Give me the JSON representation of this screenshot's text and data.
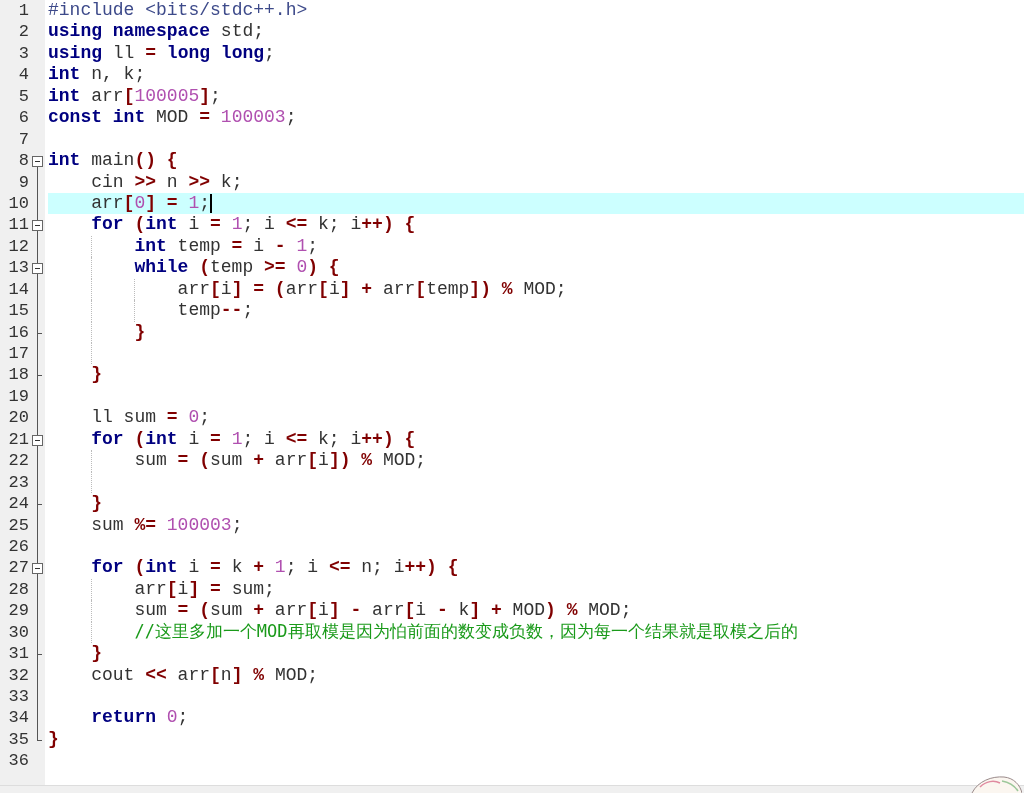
{
  "editor": {
    "lines": [
      {
        "number": "1",
        "kind": "code",
        "current": false,
        "tokens": [
          {
            "kind": "preprocessor",
            "text": "#include <bits/stdc++.h>"
          }
        ]
      },
      {
        "number": "2",
        "kind": "code",
        "current": false,
        "tokens": [
          {
            "kind": "keyword",
            "text": "using namespace"
          },
          {
            "kind": "plain",
            "text": " std;"
          }
        ]
      },
      {
        "number": "3",
        "kind": "code",
        "current": false,
        "tokens": [
          {
            "kind": "keyword",
            "text": "using"
          },
          {
            "kind": "plain",
            "text": " ll "
          },
          {
            "kind": "operator",
            "text": "="
          },
          {
            "kind": "keyword",
            "text": " long long"
          },
          {
            "kind": "plain",
            "text": ";"
          }
        ]
      },
      {
        "number": "4",
        "kind": "code",
        "current": false,
        "tokens": [
          {
            "kind": "keyword",
            "text": "int"
          },
          {
            "kind": "plain",
            "text": " n, k;"
          }
        ]
      },
      {
        "number": "5",
        "kind": "code",
        "current": false,
        "tokens": [
          {
            "kind": "keyword",
            "text": "int"
          },
          {
            "kind": "plain",
            "text": " arr"
          },
          {
            "kind": "operator",
            "text": "["
          },
          {
            "kind": "number",
            "text": "100005"
          },
          {
            "kind": "operator",
            "text": "]"
          },
          {
            "kind": "plain",
            "text": ";"
          }
        ]
      },
      {
        "number": "6",
        "kind": "code",
        "current": false,
        "tokens": [
          {
            "kind": "keyword",
            "text": "const int"
          },
          {
            "kind": "plain",
            "text": " MOD "
          },
          {
            "kind": "operator",
            "text": "="
          },
          {
            "kind": "number",
            "text": " 100003"
          },
          {
            "kind": "plain",
            "text": ";"
          }
        ]
      },
      {
        "number": "7",
        "kind": "blank",
        "current": false
      },
      {
        "number": "8",
        "kind": "code",
        "current": false,
        "tokens": [
          {
            "kind": "keyword",
            "text": "int"
          },
          {
            "kind": "plain",
            "text": " main"
          },
          {
            "kind": "operator",
            "text": "() {"
          }
        ],
        "children": [
          {
            "number": "9",
            "kind": "code",
            "current": false,
            "tokens": [
              {
                "kind": "plain",
                "text": "cin "
              },
              {
                "kind": "operator",
                "text": ">>"
              },
              {
                "kind": "plain",
                "text": " n "
              },
              {
                "kind": "operator",
                "text": ">>"
              },
              {
                "kind": "plain",
                "text": " k;"
              }
            ]
          },
          {
            "number": "10",
            "kind": "code",
            "current": true,
            "tokens": [
              {
                "kind": "plain",
                "text": "arr"
              },
              {
                "kind": "operator",
                "text": "["
              },
              {
                "kind": "number",
                "text": "0"
              },
              {
                "kind": "operator",
                "text": "]"
              },
              {
                "kind": "operator",
                "text": " ="
              },
              {
                "kind": "number",
                "text": " 1"
              },
              {
                "kind": "plain",
                "text": ";"
              }
            ]
          },
          {
            "number": "11",
            "kind": "code",
            "current": false,
            "tokens": [
              {
                "kind": "keyword",
                "text": "for"
              },
              {
                "kind": "operator",
                "text": " ("
              },
              {
                "kind": "keyword",
                "text": "int"
              },
              {
                "kind": "plain",
                "text": " i "
              },
              {
                "kind": "operator",
                "text": "="
              },
              {
                "kind": "number",
                "text": " 1"
              },
              {
                "kind": "plain",
                "text": "; i "
              },
              {
                "kind": "operator",
                "text": "<="
              },
              {
                "kind": "plain",
                "text": " k; i"
              },
              {
                "kind": "operator",
                "text": "++) {"
              }
            ],
            "children": [
              {
                "number": "12",
                "kind": "code",
                "current": false,
                "tokens": [
                  {
                    "kind": "keyword",
                    "text": "int"
                  },
                  {
                    "kind": "plain",
                    "text": " temp "
                  },
                  {
                    "kind": "operator",
                    "text": "="
                  },
                  {
                    "kind": "plain",
                    "text": " i "
                  },
                  {
                    "kind": "operator",
                    "text": "-"
                  },
                  {
                    "kind": "number",
                    "text": " 1"
                  },
                  {
                    "kind": "plain",
                    "text": ";"
                  }
                ]
              },
              {
                "number": "13",
                "kind": "code",
                "current": false,
                "tokens": [
                  {
                    "kind": "keyword",
                    "text": "while"
                  },
                  {
                    "kind": "operator",
                    "text": " ("
                  },
                  {
                    "kind": "plain",
                    "text": "temp "
                  },
                  {
                    "kind": "operator",
                    "text": ">="
                  },
                  {
                    "kind": "number",
                    "text": " 0"
                  },
                  {
                    "kind": "operator",
                    "text": ") {"
                  }
                ],
                "children": [
                  {
                    "number": "14",
                    "kind": "code",
                    "current": false,
                    "tokens": [
                      {
                        "kind": "plain",
                        "text": "arr"
                      },
                      {
                        "kind": "operator",
                        "text": "["
                      },
                      {
                        "kind": "plain",
                        "text": "i"
                      },
                      {
                        "kind": "operator",
                        "text": "]"
                      },
                      {
                        "kind": "operator",
                        "text": " = ("
                      },
                      {
                        "kind": "plain",
                        "text": "arr"
                      },
                      {
                        "kind": "operator",
                        "text": "["
                      },
                      {
                        "kind": "plain",
                        "text": "i"
                      },
                      {
                        "kind": "operator",
                        "text": "]"
                      },
                      {
                        "kind": "operator",
                        "text": " +"
                      },
                      {
                        "kind": "plain",
                        "text": " arr"
                      },
                      {
                        "kind": "operator",
                        "text": "["
                      },
                      {
                        "kind": "plain",
                        "text": "temp"
                      },
                      {
                        "kind": "operator",
                        "text": "])"
                      },
                      {
                        "kind": "operator",
                        "text": " %"
                      },
                      {
                        "kind": "plain",
                        "text": " MOD;"
                      }
                    ]
                  },
                  {
                    "number": "15",
                    "kind": "code",
                    "current": false,
                    "tokens": [
                      {
                        "kind": "plain",
                        "text": "temp"
                      },
                      {
                        "kind": "operator",
                        "text": "--"
                      },
                      {
                        "kind": "plain",
                        "text": ";"
                      }
                    ]
                  }
                ]
              },
              {
                "number": "16",
                "kind": "block_end",
                "current": false,
                "tokens": [
                  {
                    "kind": "operator",
                    "text": "}"
                  }
                ]
              },
              {
                "number": "17",
                "kind": "blank",
                "current": false
              }
            ]
          },
          {
            "number": "18",
            "kind": "block_end",
            "current": false,
            "tokens": [
              {
                "kind": "operator",
                "text": "}"
              }
            ]
          },
          {
            "number": "19",
            "kind": "blank",
            "current": false
          },
          {
            "number": "20",
            "kind": "code",
            "current": false,
            "tokens": [
              {
                "kind": "plain",
                "text": "ll sum "
              },
              {
                "kind": "operator",
                "text": "="
              },
              {
                "kind": "number",
                "text": " 0"
              },
              {
                "kind": "plain",
                "text": ";"
              }
            ]
          },
          {
            "number": "21",
            "kind": "code",
            "current": false,
            "tokens": [
              {
                "kind": "keyword",
                "text": "for"
              },
              {
                "kind": "operator",
                "text": " ("
              },
              {
                "kind": "keyword",
                "text": "int"
              },
              {
                "kind": "plain",
                "text": " i "
              },
              {
                "kind": "operator",
                "text": "="
              },
              {
                "kind": "number",
                "text": " 1"
              },
              {
                "kind": "plain",
                "text": "; i "
              },
              {
                "kind": "operator",
                "text": "<="
              },
              {
                "kind": "plain",
                "text": " k; i"
              },
              {
                "kind": "operator",
                "text": "++) {"
              }
            ],
            "children": [
              {
                "number": "22",
                "kind": "code",
                "current": false,
                "tokens": [
                  {
                    "kind": "plain",
                    "text": "sum "
                  },
                  {
                    "kind": "operator",
                    "text": "= ("
                  },
                  {
                    "kind": "plain",
                    "text": "sum "
                  },
                  {
                    "kind": "operator",
                    "text": "+"
                  },
                  {
                    "kind": "plain",
                    "text": " arr"
                  },
                  {
                    "kind": "operator",
                    "text": "["
                  },
                  {
                    "kind": "plain",
                    "text": "i"
                  },
                  {
                    "kind": "operator",
                    "text": "])"
                  },
                  {
                    "kind": "operator",
                    "text": " %"
                  },
                  {
                    "kind": "plain",
                    "text": " MOD;"
                  }
                ]
              },
              {
                "number": "23",
                "kind": "blank",
                "current": false
              }
            ]
          },
          {
            "number": "24",
            "kind": "block_end",
            "current": false,
            "tokens": [
              {
                "kind": "operator",
                "text": "}"
              }
            ]
          },
          {
            "number": "25",
            "kind": "code",
            "current": false,
            "tokens": [
              {
                "kind": "plain",
                "text": "sum "
              },
              {
                "kind": "operator",
                "text": "%="
              },
              {
                "kind": "number",
                "text": " 100003"
              },
              {
                "kind": "plain",
                "text": ";"
              }
            ]
          },
          {
            "number": "26",
            "kind": "blank",
            "current": false
          },
          {
            "number": "27",
            "kind": "code",
            "current": false,
            "tokens": [
              {
                "kind": "keyword",
                "text": "for"
              },
              {
                "kind": "operator",
                "text": " ("
              },
              {
                "kind": "keyword",
                "text": "int"
              },
              {
                "kind": "plain",
                "text": " i "
              },
              {
                "kind": "operator",
                "text": "="
              },
              {
                "kind": "plain",
                "text": " k "
              },
              {
                "kind": "operator",
                "text": "+"
              },
              {
                "kind": "number",
                "text": " 1"
              },
              {
                "kind": "plain",
                "text": "; i "
              },
              {
                "kind": "operator",
                "text": "<="
              },
              {
                "kind": "plain",
                "text": " n; i"
              },
              {
                "kind": "operator",
                "text": "++) {"
              }
            ],
            "children": [
              {
                "number": "28",
                "kind": "code",
                "current": false,
                "tokens": [
                  {
                    "kind": "plain",
                    "text": "arr"
                  },
                  {
                    "kind": "operator",
                    "text": "["
                  },
                  {
                    "kind": "plain",
                    "text": "i"
                  },
                  {
                    "kind": "operator",
                    "text": "]"
                  },
                  {
                    "kind": "operator",
                    "text": " ="
                  },
                  {
                    "kind": "plain",
                    "text": " sum;"
                  }
                ]
              },
              {
                "number": "29",
                "kind": "code",
                "current": false,
                "tokens": [
                  {
                    "kind": "plain",
                    "text": "sum "
                  },
                  {
                    "kind": "operator",
                    "text": "= ("
                  },
                  {
                    "kind": "plain",
                    "text": "sum "
                  },
                  {
                    "kind": "operator",
                    "text": "+"
                  },
                  {
                    "kind": "plain",
                    "text": " arr"
                  },
                  {
                    "kind": "operator",
                    "text": "["
                  },
                  {
                    "kind": "plain",
                    "text": "i"
                  },
                  {
                    "kind": "operator",
                    "text": "]"
                  },
                  {
                    "kind": "operator",
                    "text": " -"
                  },
                  {
                    "kind": "plain",
                    "text": " arr"
                  },
                  {
                    "kind": "operator",
                    "text": "["
                  },
                  {
                    "kind": "plain",
                    "text": "i "
                  },
                  {
                    "kind": "operator",
                    "text": "-"
                  },
                  {
                    "kind": "plain",
                    "text": " k"
                  },
                  {
                    "kind": "operator",
                    "text": "]"
                  },
                  {
                    "kind": "operator",
                    "text": " +"
                  },
                  {
                    "kind": "plain",
                    "text": " MOD"
                  },
                  {
                    "kind": "operator",
                    "text": ")"
                  },
                  {
                    "kind": "operator",
                    "text": " %"
                  },
                  {
                    "kind": "plain",
                    "text": " MOD;"
                  }
                ]
              },
              {
                "number": "30",
                "kind": "code",
                "current": false,
                "tokens": [
                  {
                    "kind": "comment",
                    "text": "//这里多加一个MOD再取模是因为怕前面的数变成负数，因为每一个结果就是取模之后的"
                  }
                ]
              }
            ]
          },
          {
            "number": "31",
            "kind": "block_end",
            "current": false,
            "tokens": [
              {
                "kind": "operator",
                "text": "}"
              }
            ]
          },
          {
            "number": "32",
            "kind": "code",
            "current": false,
            "tokens": [
              {
                "kind": "plain",
                "text": "cout "
              },
              {
                "kind": "operator",
                "text": "<<"
              },
              {
                "kind": "plain",
                "text": " arr"
              },
              {
                "kind": "operator",
                "text": "["
              },
              {
                "kind": "plain",
                "text": "n"
              },
              {
                "kind": "operator",
                "text": "]"
              },
              {
                "kind": "operator",
                "text": " %"
              },
              {
                "kind": "plain",
                "text": " MOD;"
              }
            ]
          },
          {
            "number": "33",
            "kind": "blank",
            "current": false
          },
          {
            "number": "34",
            "kind": "code",
            "current": false,
            "tokens": [
              {
                "kind": "keyword",
                "text": "return"
              },
              {
                "kind": "number",
                "text": " 0"
              },
              {
                "kind": "plain",
                "text": ";"
              }
            ]
          }
        ]
      },
      {
        "number": "35",
        "kind": "block_end",
        "current": false,
        "tokens": [
          {
            "kind": "operator",
            "text": "}"
          }
        ]
      },
      {
        "number": "36",
        "kind": "blank",
        "current": false
      }
    ]
  }
}
